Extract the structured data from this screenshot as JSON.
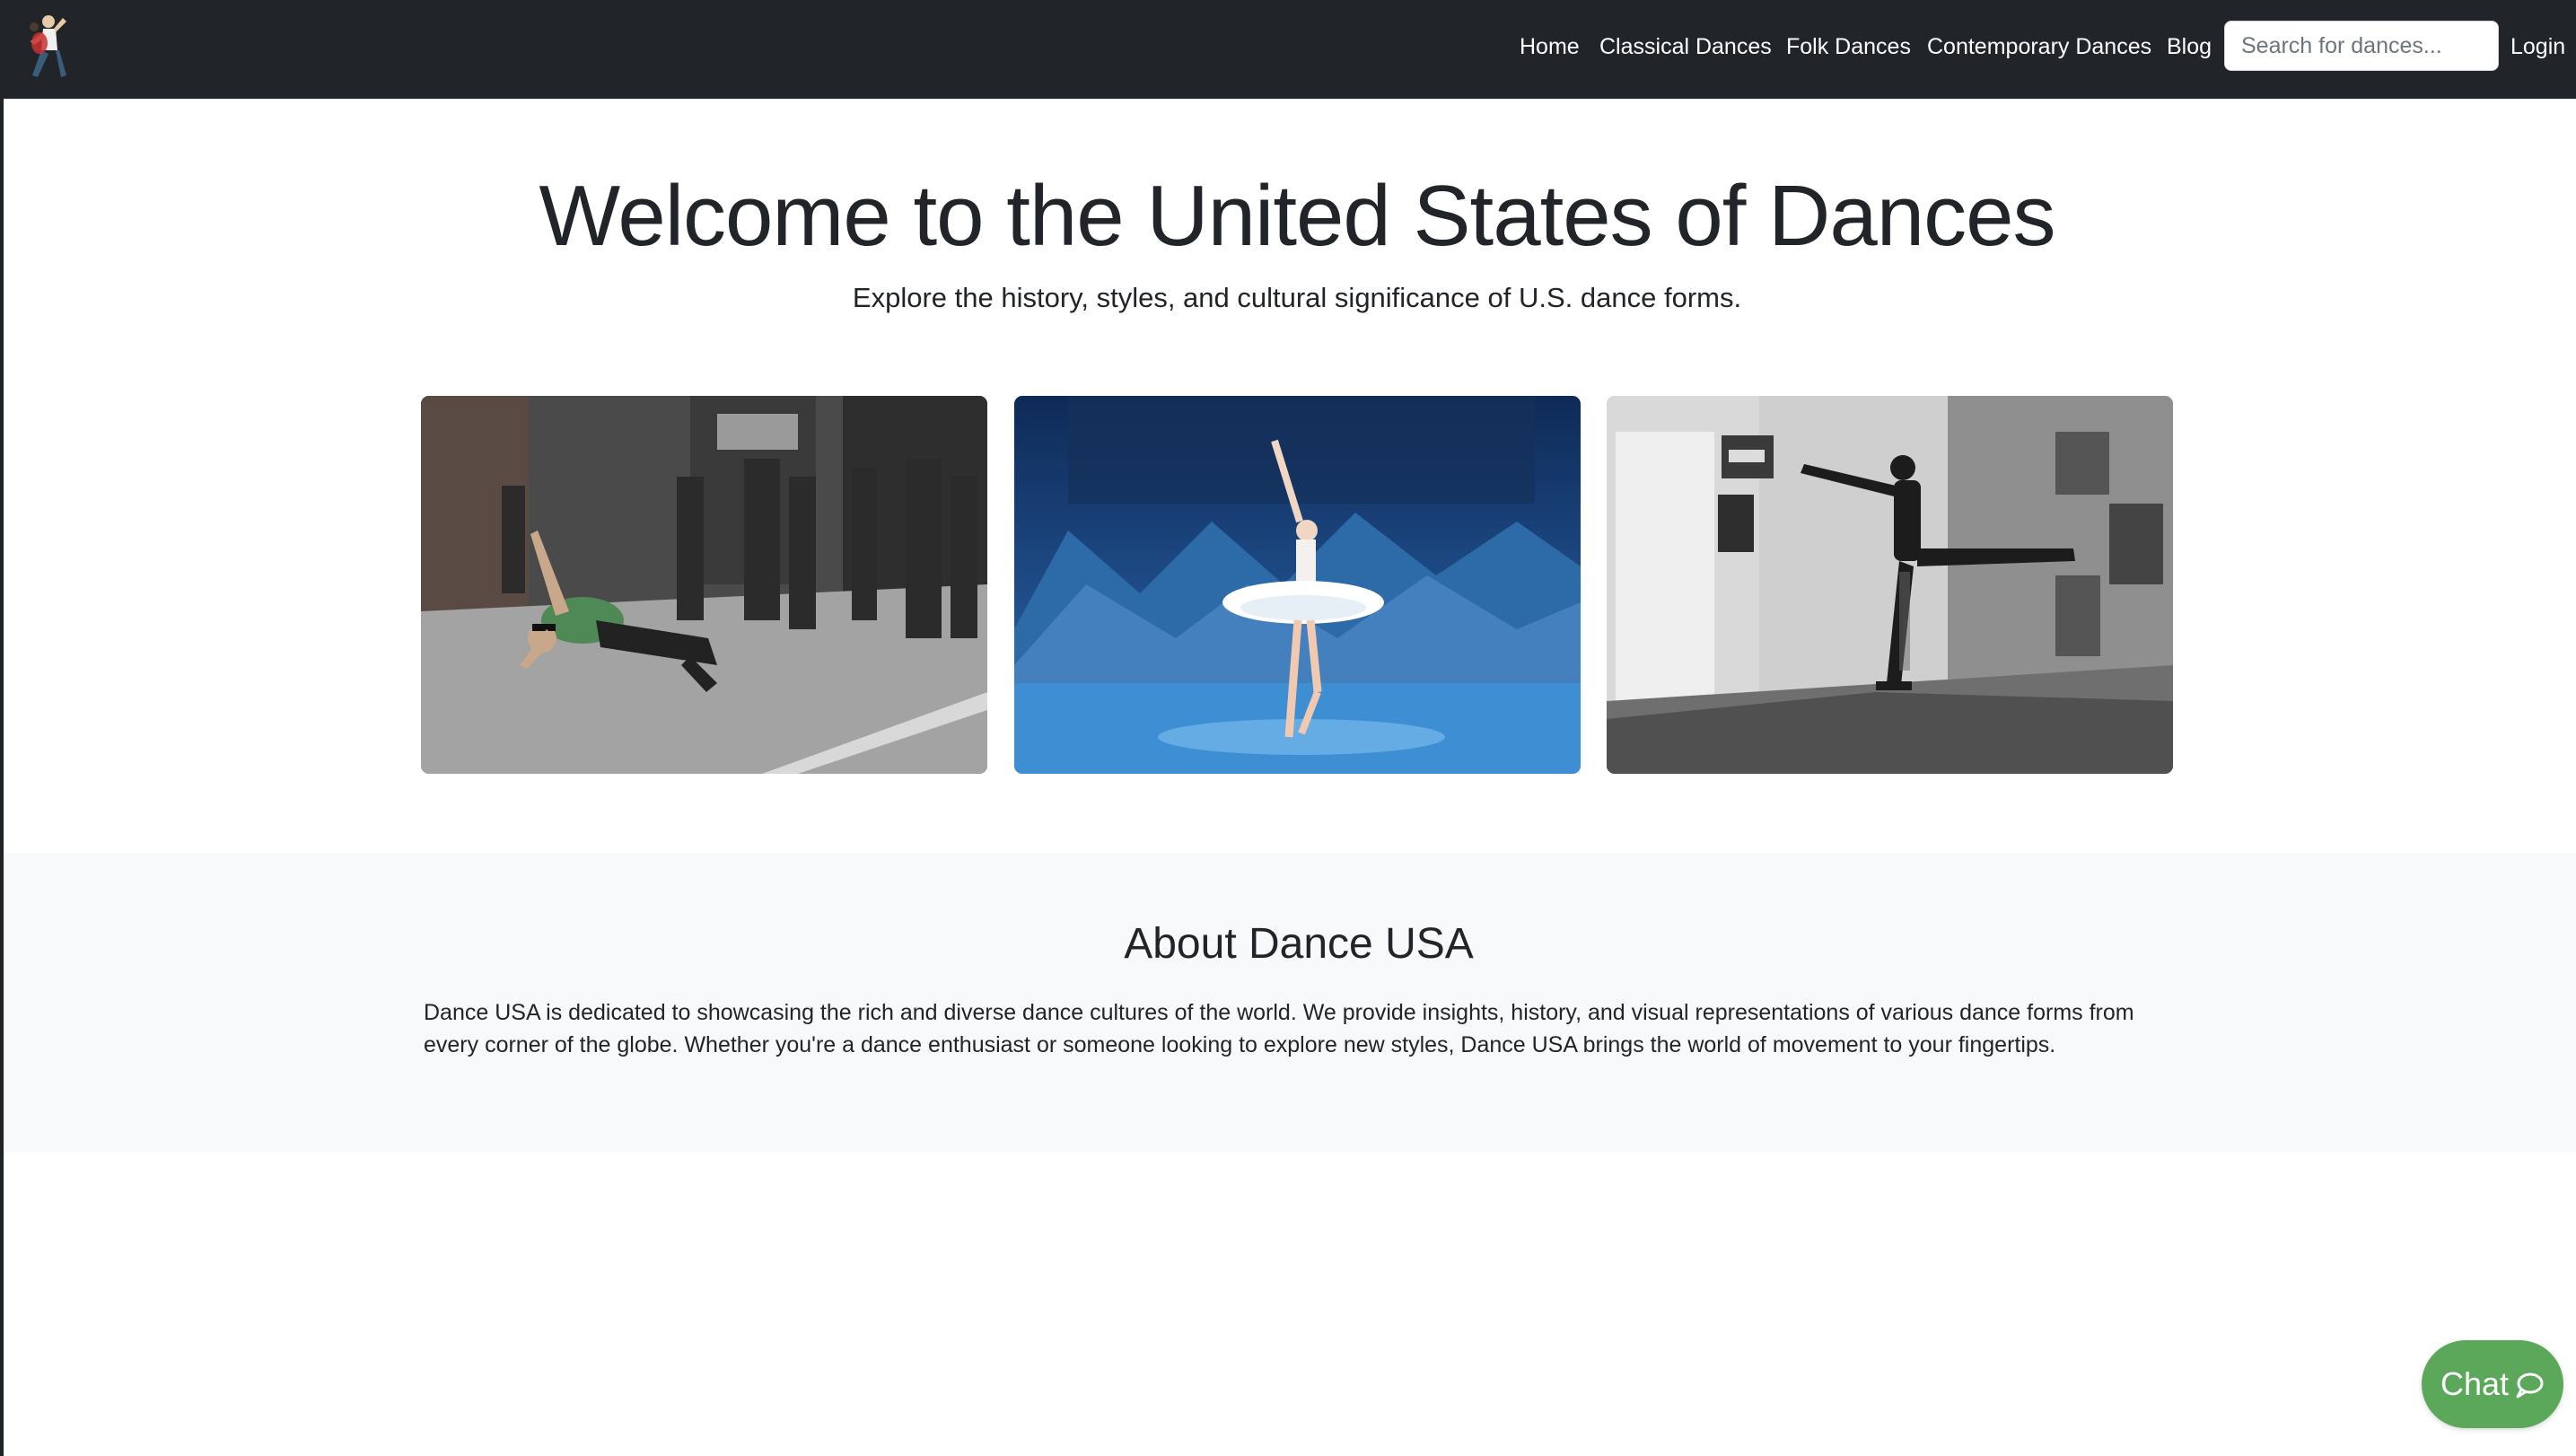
{
  "nav": {
    "logo_icon": "dancer-logo-icon",
    "links": {
      "home": "Home",
      "classical": "Classical Dances",
      "folk": "Folk Dances",
      "contemporary": "Contemporary Dances",
      "blog": "Blog",
      "login": "Login"
    },
    "search": {
      "placeholder": "Search for dances...",
      "value": ""
    }
  },
  "hero": {
    "title": "Welcome to the United States of Dances",
    "subtitle": "Explore the history, styles, and cultural significance of U.S. dance forms."
  },
  "gallery": [
    {
      "icon": "breakdancer-street-photo"
    },
    {
      "icon": "ballerina-stage-photo"
    },
    {
      "icon": "street-dancer-bw-photo"
    }
  ],
  "about": {
    "title": "About Dance USA",
    "text": "Dance USA is dedicated to showcasing the rich and diverse dance cultures of the world. We provide insights, history, and visual representations of various dance forms from every corner of the globe. Whether you're a dance enthusiast or someone looking to explore new styles, Dance USA brings the world of movement to your fingertips."
  },
  "chat": {
    "label": "Chat",
    "icon": "chat-bubble-icon"
  },
  "colors": {
    "navbar": "#212529",
    "about_bg": "#f8f9fa",
    "chat": "#5ba85a",
    "text": "#212529"
  }
}
